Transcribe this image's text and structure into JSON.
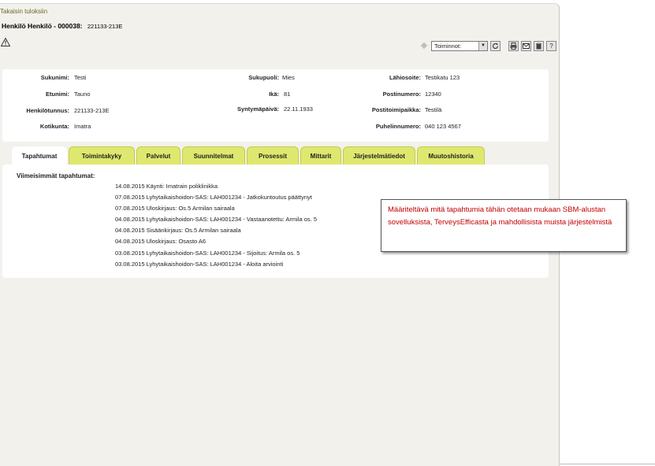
{
  "back_link": "Takaisin tuloksiin",
  "person": {
    "title_label": "Henkilö Henkilö - 000038:",
    "title_id": "221133-213E"
  },
  "toolbar": {
    "actions_select": "Toiminnot:",
    "icons": [
      "refresh-icon",
      "print-icon",
      "mail-icon",
      "clipboard-icon",
      "help-icon"
    ],
    "help_label": "?"
  },
  "details": {
    "sukunimi": {
      "label": "Sukunimi:",
      "value": "Testi"
    },
    "etunimi": {
      "label": "Etunimi:",
      "value": "Tauno"
    },
    "henkilotunnus": {
      "label": "Henkilötunnus:",
      "value": "221133-213E"
    },
    "kotikunta": {
      "label": "Kotikunta:",
      "value": "Imatra"
    },
    "sukupuoli": {
      "label": "Sukupuoli:",
      "value": "Mies"
    },
    "ika": {
      "label": "Ikä:",
      "value": "81"
    },
    "syntymapaiva": {
      "label": "Syntymäpäivä:",
      "value": "22.11.1933"
    },
    "lahiosoite": {
      "label": "Lähiosoite:",
      "value": "Testikatu 123"
    },
    "postinumero": {
      "label": "Postinumero:",
      "value": "12340"
    },
    "postitoimipaikka": {
      "label": "Postitoimipaikka:",
      "value": "Testilä"
    },
    "puhelinnumero": {
      "label": "Puhelinnumero:",
      "value": "040 123 4567"
    }
  },
  "tabs": [
    {
      "label": "Tapahtumat",
      "active": true
    },
    {
      "label": "Toimintakyky",
      "active": false
    },
    {
      "label": "Palvelut",
      "active": false
    },
    {
      "label": "Suunnitelmat",
      "active": false
    },
    {
      "label": "Prosessit",
      "active": false
    },
    {
      "label": "Mittarit",
      "active": false
    },
    {
      "label": "Järjestelmätiedot",
      "active": false
    },
    {
      "label": "Muutoshistoria",
      "active": false
    }
  ],
  "events": {
    "title": "Viimeisimmät tapahtumat:",
    "rows": [
      "14.08.2015 Käynti: Imatrain poliklinikka",
      "07.08.2015 Lyhytaikaishoidon-SAS: LAH001234 - Jatkokuntoutus päättynyt",
      "07.08.2015 Uloskirjaus: Os.5 Armilan sairaala",
      "04.08.2015 Lyhytaikaishoidon-SAS: LAH001234 - Vastaanotettu: Armila os. 5",
      "04.08.2015 Sisäänkirjaus: Os.5 Armilan sairaala",
      "04.08.2015 Uloskirjaus: Osasto A6",
      "03.08.2015 Lyhytaikaishoidon-SAS: LAH001234 - Sijoitus: Armila os. 5",
      "03.08.2015 Lyhytaikaishoidon-SAS: LAH001234 - Aloita arviointi"
    ]
  },
  "note": "Määriteltävä mitä tapahtumia tähän otetaan mukaan SBM-alustan sovelluksista, TerveysEfficasta ja mahdollisista muista järjestelmistä"
}
